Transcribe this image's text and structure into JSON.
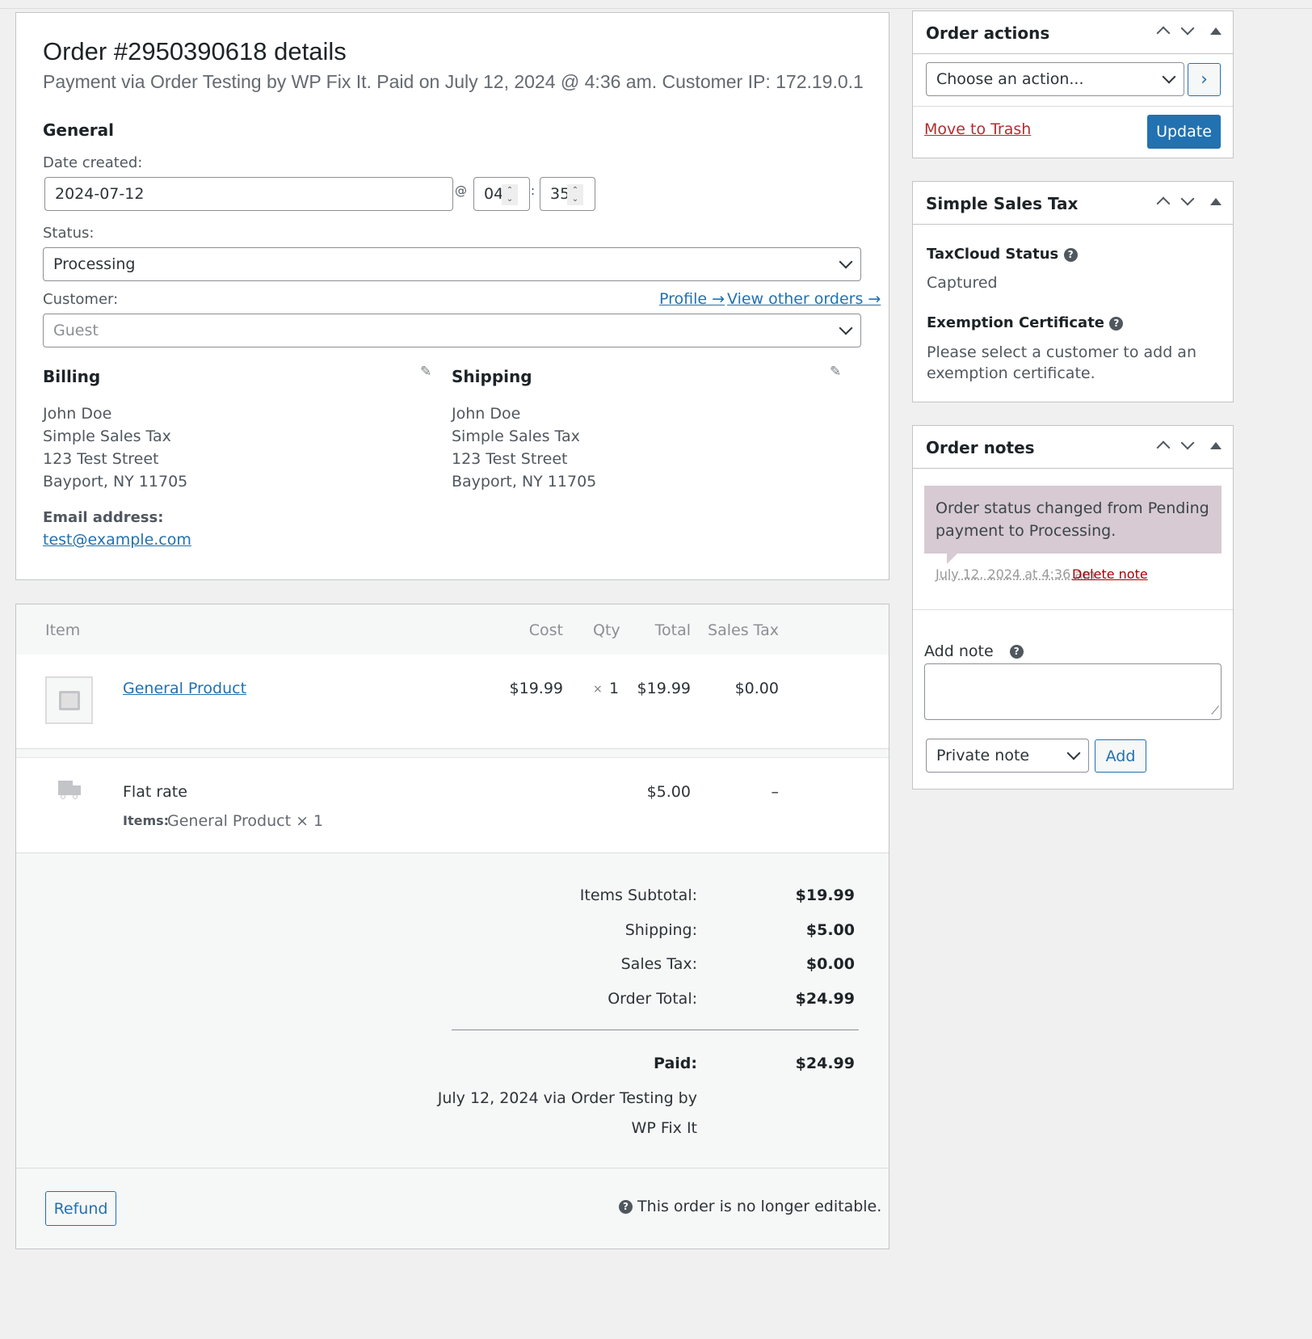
{
  "order": {
    "title": "Order #2950390618 details",
    "subtitle": "Payment via Order Testing by WP Fix It. Paid on July 12, 2024 @ 4:36 am. Customer IP: 172.19.0.1",
    "general_heading": "General",
    "date_label": "Date created:",
    "date_value": "2024-07-12",
    "at": "@",
    "hour": "04",
    "colon": ":",
    "minute": "35",
    "status_label": "Status:",
    "status_value": "Processing",
    "customer_label": "Customer:",
    "profile_link": "Profile →",
    "other_orders_link": "View other orders →",
    "customer_placeholder": "Guest"
  },
  "billing": {
    "heading": "Billing",
    "lines": [
      "John Doe",
      "Simple Sales Tax",
      "123 Test Street",
      "Bayport, NY 11705"
    ],
    "email_label": "Email address:",
    "email": "test@example.com"
  },
  "shipping": {
    "heading": "Shipping",
    "lines": [
      "John Doe",
      "Simple Sales Tax",
      "123 Test Street",
      "Bayport, NY 11705"
    ]
  },
  "items": {
    "columns": [
      "Item",
      "Cost",
      "Qty",
      "Total",
      "Sales Tax"
    ],
    "product": {
      "name": "General Product",
      "cost": "$19.99",
      "qty_x": "×",
      "qty": "1",
      "total": "$19.99",
      "tax": "$0.00"
    },
    "shipping_line": {
      "name": "Flat rate",
      "total": "$5.00",
      "tax": "–",
      "items_label": "Items:",
      "items_value": "General Product × 1"
    }
  },
  "totals": {
    "subtotal_label": "Items Subtotal:",
    "subtotal": "$19.99",
    "shipping_label": "Shipping:",
    "shipping": "$5.00",
    "tax_label": "Sales Tax:",
    "tax": "$0.00",
    "total_label": "Order Total:",
    "total": "$24.99",
    "paid_label": "Paid:",
    "paid": "$24.99",
    "paid_note_1": "July 12, 2024 via Order Testing by",
    "paid_note_2": "WP Fix It"
  },
  "footer": {
    "refund": "Refund",
    "not_editable": "This order is no longer editable."
  },
  "actions": {
    "title": "Order actions",
    "select": "Choose an action...",
    "trash": "Move to Trash",
    "update": "Update"
  },
  "sst": {
    "title": "Simple Sales Tax",
    "taxcloud_label": "TaxCloud Status",
    "taxcloud_value": "Captured",
    "exemption_label": "Exemption Certificate",
    "exemption_text_1": "Please select a customer to add an",
    "exemption_text_2": "exemption certificate."
  },
  "notes": {
    "title": "Order notes",
    "note_1": "Order status changed from Pending",
    "note_2": "payment to Processing.",
    "note_meta": "July 12, 2024 at 4:36 am",
    "delete": "Delete note",
    "add_label": "Add note",
    "type": "Private note",
    "add_btn": "Add"
  },
  "colors": {
    "primary": "#2271b1",
    "danger": "#b32d2e",
    "note_bg": "#d7cad2"
  }
}
